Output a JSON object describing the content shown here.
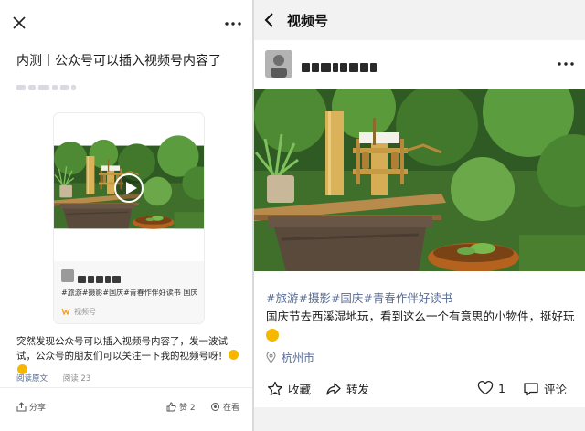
{
  "left_panel": {
    "article_title": "内测丨公众号可以插入视频号内容了",
    "embedded_card": {
      "tags": "#旅游#摄影#国庆#青春作伴好读书 国庆...",
      "channel_label": "视频号"
    },
    "body_text": "突然发现公众号可以插入视频号内容了，发一波试试，公众号的朋友们可以关注一下我的视频号呀！",
    "read_original": "阅读原文",
    "read_count": "阅读 23",
    "bottom_bar": {
      "share": "分享",
      "like": "赞 2",
      "watching": "在看"
    }
  },
  "right_panel": {
    "header_title": "视频号",
    "post": {
      "tags": "#旅游#摄影#国庆#青春作伴好读书",
      "text": "国庆节去西溪湿地玩，看到这么一个有意思的小物件，挺好玩",
      "location": "杭州市"
    },
    "actions": {
      "favorite": "收藏",
      "forward": "转发",
      "like_count": "1",
      "comment": "评论"
    }
  },
  "colors": {
    "link_blue": "#576b95",
    "header_gray": "#f2f2f2",
    "emoji_yellow": "#f5b700"
  }
}
